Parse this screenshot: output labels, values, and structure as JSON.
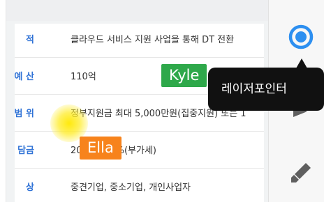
{
  "table": {
    "rows": [
      {
        "label": "적",
        "value": "클라우드 서비스 지원 사업을 통해 DT 전환"
      },
      {
        "label": "예 산",
        "value": "110억"
      },
      {
        "label": "범 위",
        "value": "정부지원금 최대 5,000만원(집중지원) 또는 1"
      },
      {
        "label": "담금",
        "value": "20% + 10%(부가세)"
      },
      {
        "label": "상",
        "value": "중견기업, 중소기업, 개인사업자"
      }
    ]
  },
  "cursors": {
    "kyle": "Kyle",
    "ella": "Ella"
  },
  "toolbar": {
    "tooltip": "레이저포인터",
    "tools": [
      "laser-pointer-icon",
      "arrow-icon",
      "highlighter-icon"
    ]
  },
  "colors": {
    "label_blue": "#2f72d6",
    "laser_blue": "#2d8ff0",
    "kyle_green": "#2ea84a",
    "ella_orange": "#f7831c",
    "highlight_yellow": "#ffe800"
  }
}
